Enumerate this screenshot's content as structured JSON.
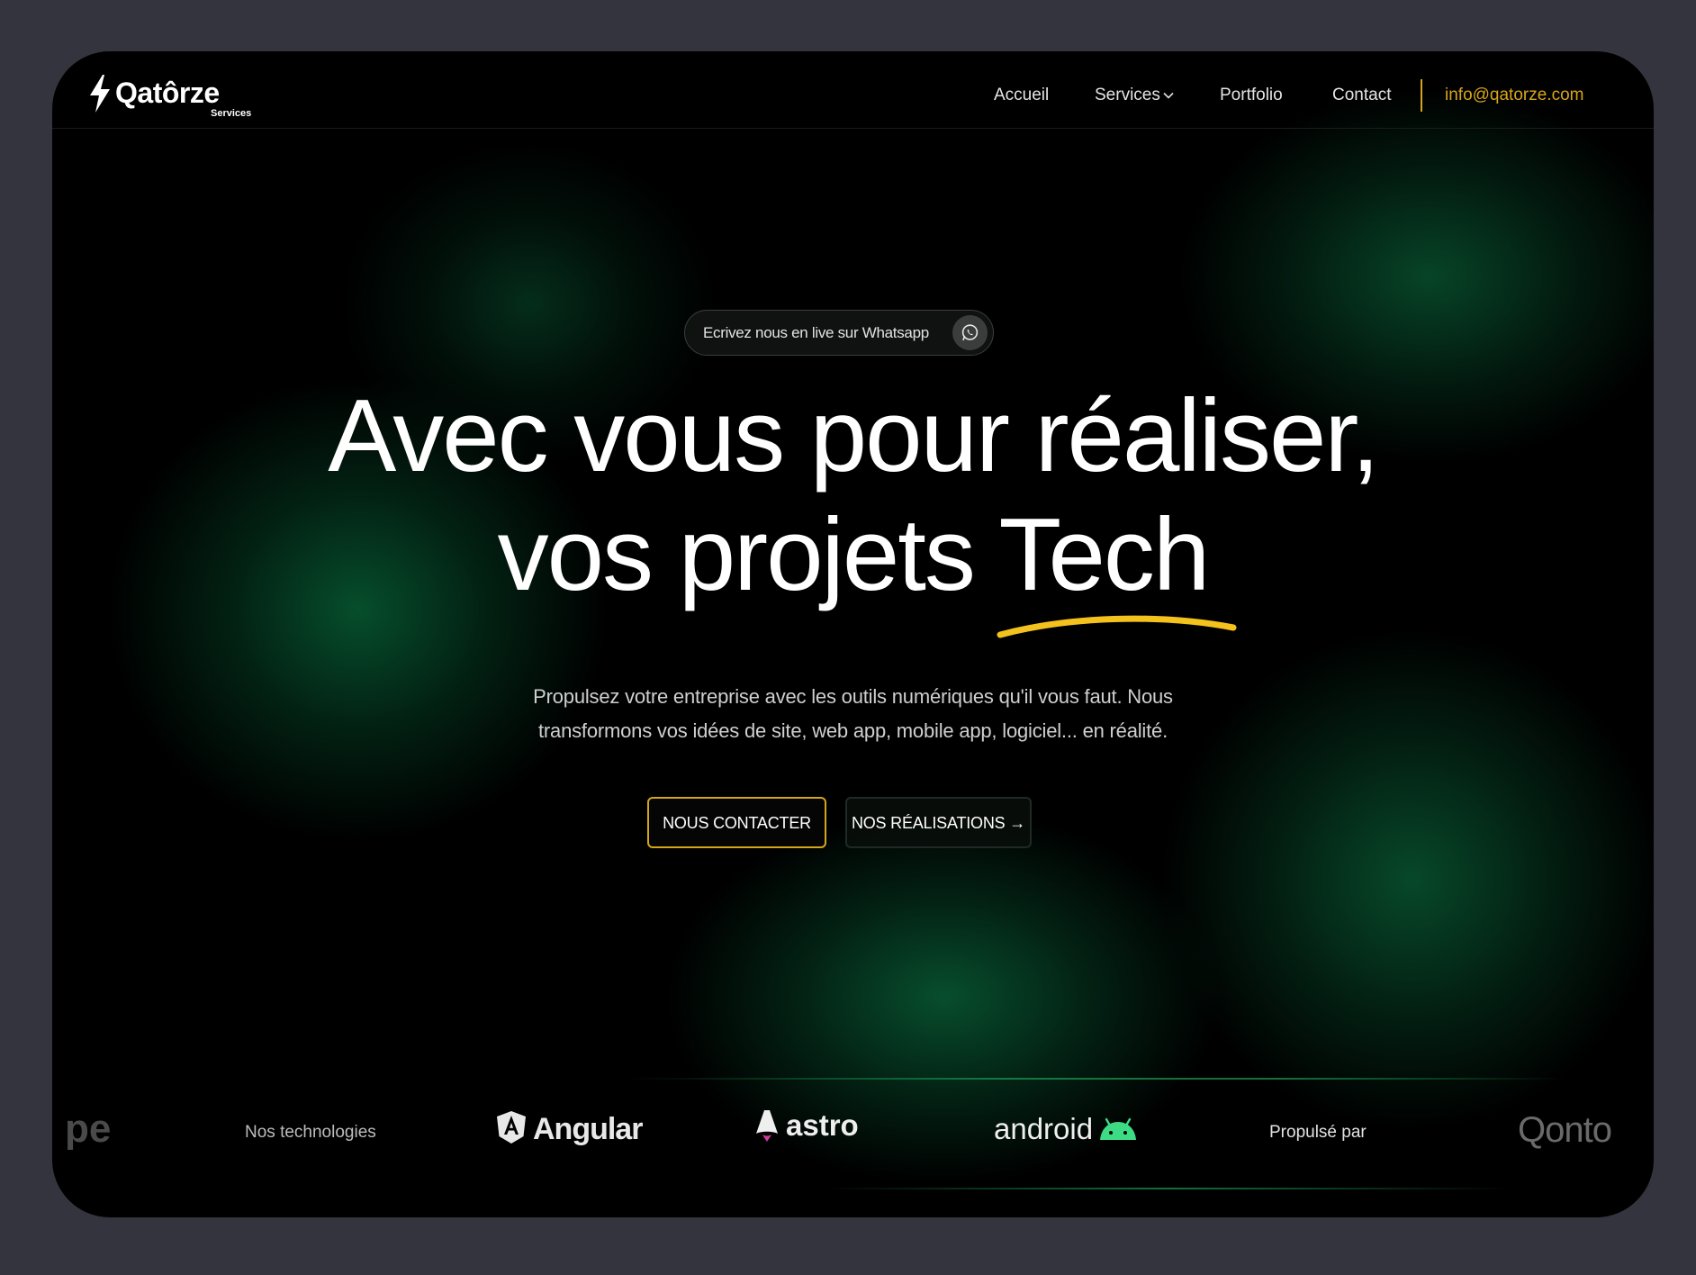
{
  "brand": {
    "name": "Qatôrze",
    "subtitle": "Services"
  },
  "nav": {
    "items": [
      {
        "label": "Accueil"
      },
      {
        "label": "Services"
      },
      {
        "label": "Portfolio"
      },
      {
        "label": "Contact"
      }
    ],
    "email": "info@qatorze.com"
  },
  "hero": {
    "whatsapp_pill": "Ecrivez nous en live sur Whatsapp",
    "headline_line1": "Avec vous pour réaliser,",
    "headline_line2": "vos projets Tech",
    "subtitle_line1": "Propulsez votre entreprise avec les outils numériques qu'il vous faut. Nous",
    "subtitle_line2": "transformons vos idées de site, web app, mobile app, logiciel... en réalité.",
    "cta_primary": "NOUS CONTACTER",
    "cta_secondary": "NOS RÉALISATIONS →"
  },
  "tech_bar": {
    "fragment": "pe",
    "label": "Nos technologies",
    "logos": [
      "Angular",
      "astro",
      "android",
      "Qonto"
    ],
    "powered_by": "Propulsé par"
  },
  "colors": {
    "background": "#33343d",
    "frame": "#000000",
    "accent": "#d6a51a",
    "glow_green": "#06522e",
    "android_green": "#3ddc84"
  },
  "icons": {
    "logo": "lightning-bolt-icon",
    "services_dropdown": "chevron-down-icon",
    "whatsapp": "whatsapp-icon",
    "angular": "angular-logo-icon",
    "astro": "astro-logo-icon",
    "android": "android-robot-icon"
  }
}
